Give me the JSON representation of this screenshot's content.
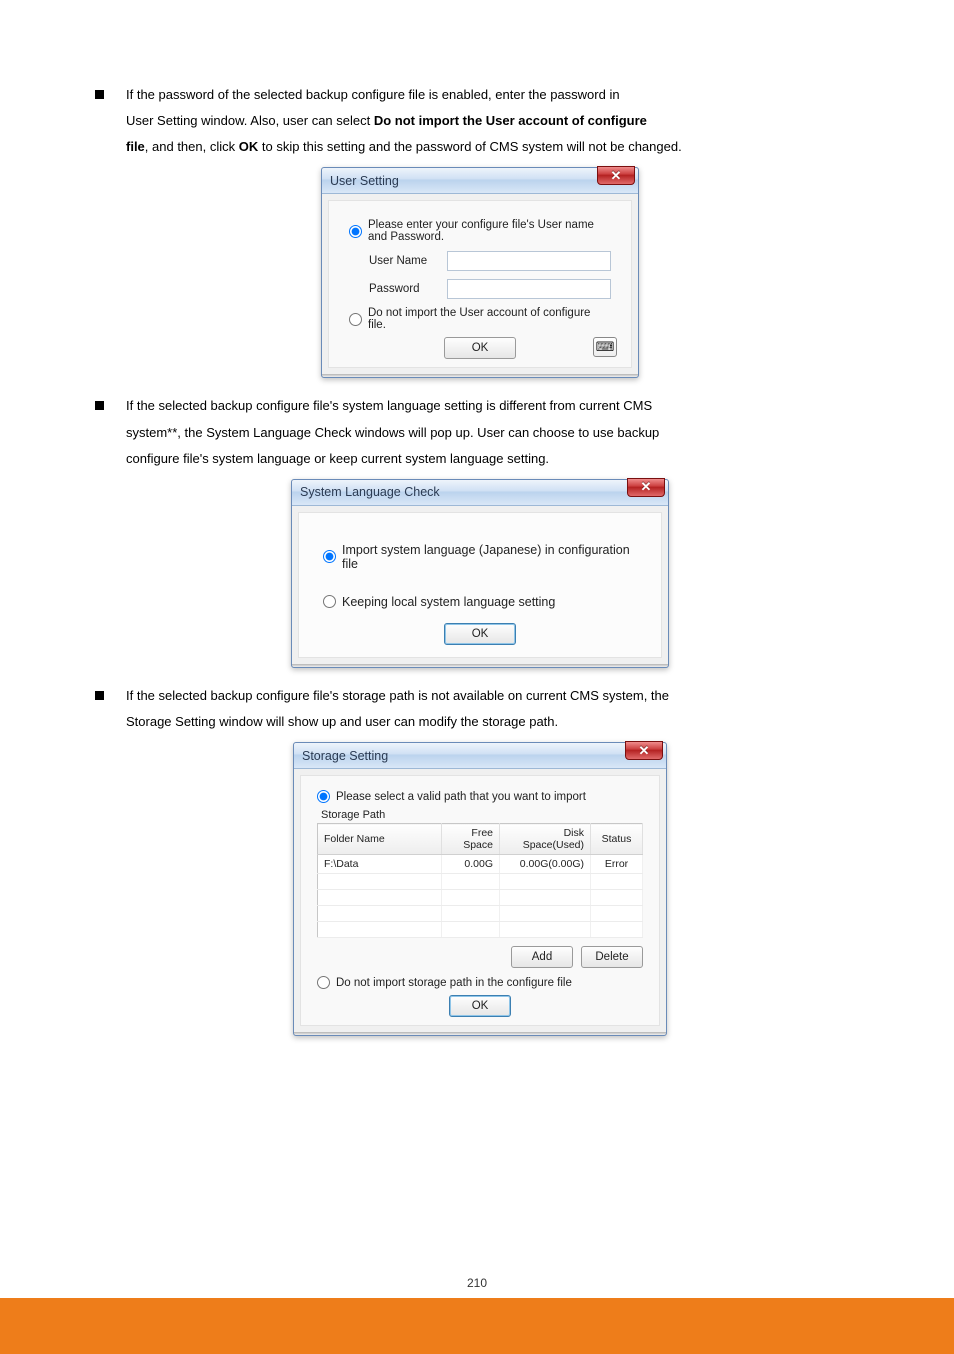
{
  "bullets": {
    "b1": "If the password of the selected backup configure file is enabled, enter the password in",
    "b1_line2_prefix": "User Setting window. Also, user can select",
    "b1_bold": " Do not import the User account of configure",
    "b1_line3": "file",
    "b1_after": ", and then, click",
    "b1_ok": " OK",
    "b1_tail": " to skip this setting and the password of CMS system will not be changed.",
    "b2": "If the selected backup configure file's system language setting is different from current CMS",
    "b2_line2": "system**, the System Language Check windows will pop up. User can choose to use backup",
    "b2_line3": "configure file's system language or keep current system language setting.",
    "b3": "If the selected backup configure file's storage path is not available on current CMS system, the",
    "b3_line2": "Storage Setting window will show up and user can modify the storage path."
  },
  "dlg1": {
    "title": "User Setting",
    "opt1": "Please enter your configure file's User name and Password.",
    "username_label": "User Name",
    "password_label": "Password",
    "opt2": "Do not import the User account of configure file.",
    "ok": "OK"
  },
  "dlg2": {
    "title": "System Language Check",
    "opt1": "Import system language (Japanese) in configuration file",
    "opt2": "Keeping local system language setting",
    "ok": "OK"
  },
  "dlg3": {
    "title": "Storage Setting",
    "opt1": "Please select a valid path that you want to import",
    "group": "Storage Path",
    "cols": {
      "c1": "Folder Name",
      "c2": "Free Space",
      "c3": "Disk Space(Used)",
      "c4": "Status"
    },
    "row": {
      "folder": "F:\\Data",
      "free": "0.00G",
      "disk": "0.00G(0.00G)",
      "status": "Error"
    },
    "add": "Add",
    "del": "Delete",
    "opt2": "Do not import storage path in the configure file",
    "ok": "OK"
  },
  "footer": "210"
}
